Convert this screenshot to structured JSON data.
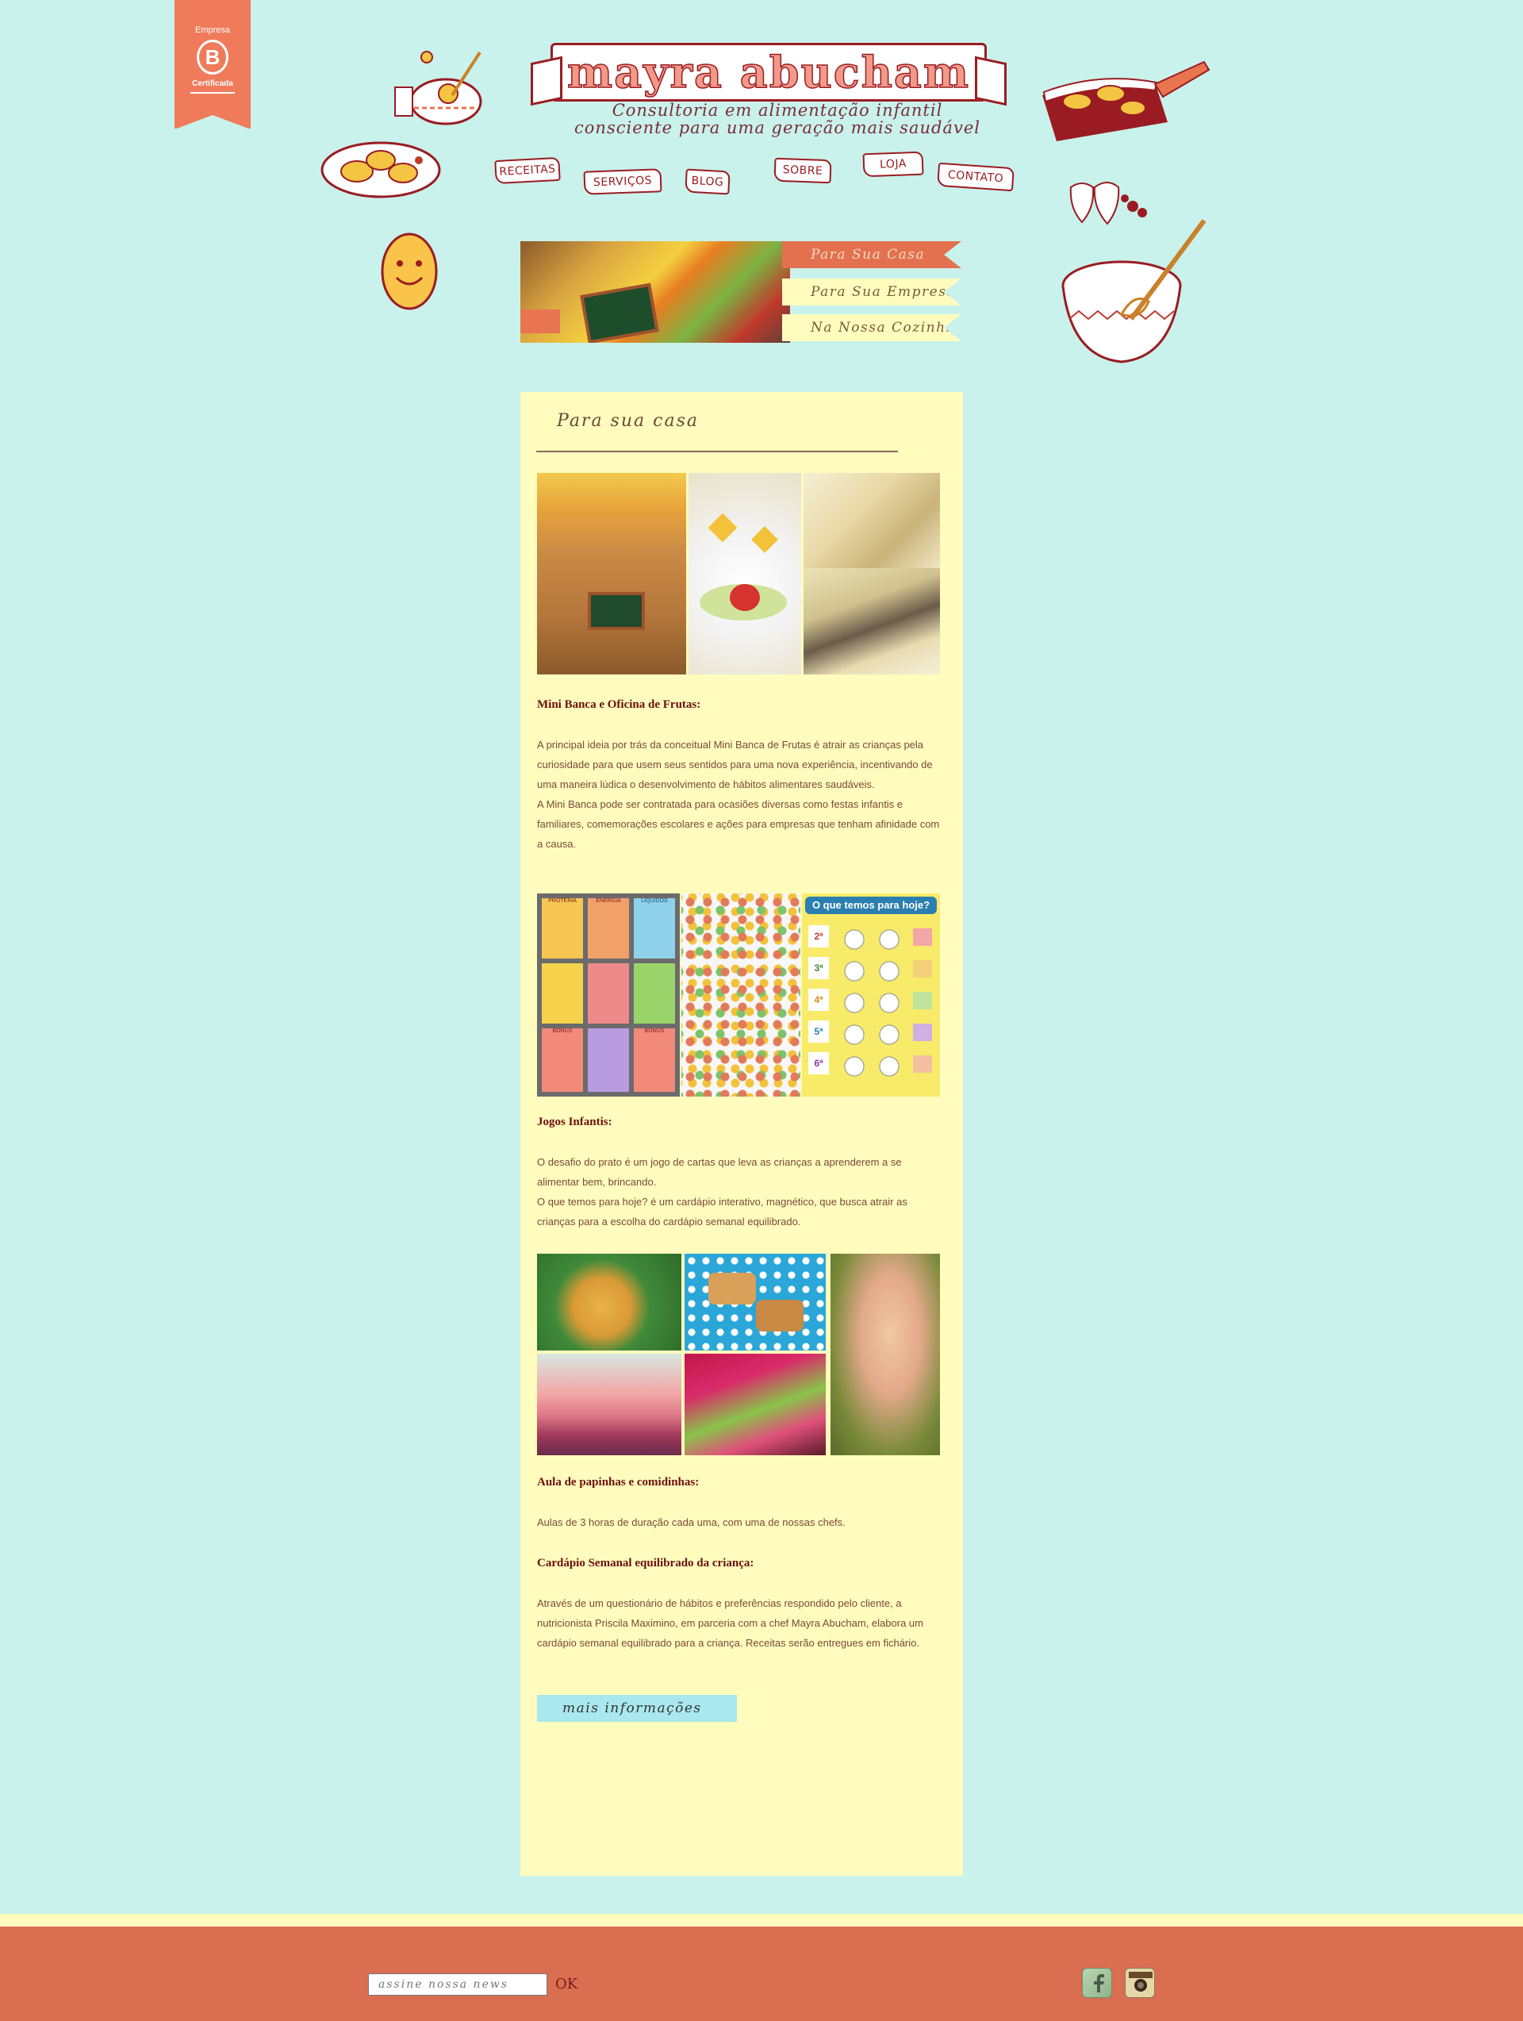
{
  "badge": {
    "line1": "Empresa",
    "letter": "B",
    "line2": "Certificada"
  },
  "header": {
    "title": "mayra abucham",
    "tagline_line1": "Consultoria em alimentação infantil",
    "tagline_line2": "consciente para uma geração mais saudável"
  },
  "nav": {
    "items": [
      {
        "label": "RECEITAS"
      },
      {
        "label": "SERVIÇOS"
      },
      {
        "label": "BLOG"
      },
      {
        "label": "SOBRE"
      },
      {
        "label": "LOJA"
      },
      {
        "label": "CONTATO"
      }
    ]
  },
  "hero": {
    "tabs": [
      {
        "label": "Para Sua Casa",
        "bg": "#e3714f",
        "fg": "#f7d9c4"
      },
      {
        "label": "Para Sua Empresa",
        "bg": "#fffcbd",
        "fg": "#7a5a3a"
      },
      {
        "label": "Na Nossa Cozinha",
        "bg": "#fffcbd",
        "fg": "#7a5a3a"
      }
    ]
  },
  "content": {
    "section_title": "Para sua casa",
    "blocks": [
      {
        "heading": "Mini Banca  e Oficina de Frutas:",
        "paragraphs": [
          "A principal ideia por trás da conceitual Mini Banca de Frutas é atrair as crianças pela curiosidade para que usem seus sentidos para uma nova experiência, incentivando de uma maneira lúdica o desenvolvimento de hábitos alimentares saudáveis.",
          "A Mini Banca pode ser contratada para ocasiões diversas como festas infantis e familiares, comemorações escolares e ações para empresas que tenham afinidade com a causa."
        ]
      },
      {
        "heading": "Jogos Infantis:",
        "paragraphs": [
          "O desafio do prato é um jogo de cartas que leva as crianças a aprenderem a se alimentar bem, brincando.",
          "O que temos para hoje? é um cardápio interativo, magnético, que busca atrair as crianças para a escolha do cardápio semanal equilibrado."
        ]
      },
      {
        "heading": "Aula de papinhas e comidinhas:",
        "paragraphs": [
          "Aulas de 3 horas de duração cada uma, com uma de nossas chefs."
        ]
      },
      {
        "heading": "Cardápio Semanal equilibrado da criança:",
        "paragraphs": [
          "Através de um questionário de hábitos e preferências respondido pelo cliente, a nutricionista Priscila Maximino, em parceria com a chef Mayra Abucham, elabora um cardápio semanal equilibrado para a criança. Receitas serão entregues em fichário."
        ]
      }
    ],
    "games_card_labels": [
      "PROTEÍNA",
      "ENERGIA",
      "LÍQUIDOS",
      "BONUS",
      "BONUS"
    ],
    "menu_board_title": "O que temos para hoje?",
    "menu_board_days": [
      "2ª",
      "3ª",
      "4ª",
      "5ª",
      "6ª"
    ],
    "more_button": "mais informações"
  },
  "footer": {
    "newsletter_placeholder": "assine nossa news",
    "ok_label": "OK",
    "social": [
      {
        "icon": "facebook-icon"
      },
      {
        "icon": "instagram-icon"
      }
    ]
  },
  "colors": {
    "background": "#c8f2eb",
    "content_bg": "#fffcbd",
    "accent": "#e3714f",
    "brand_red": "#9a1c22",
    "footer": "#d96e51"
  }
}
